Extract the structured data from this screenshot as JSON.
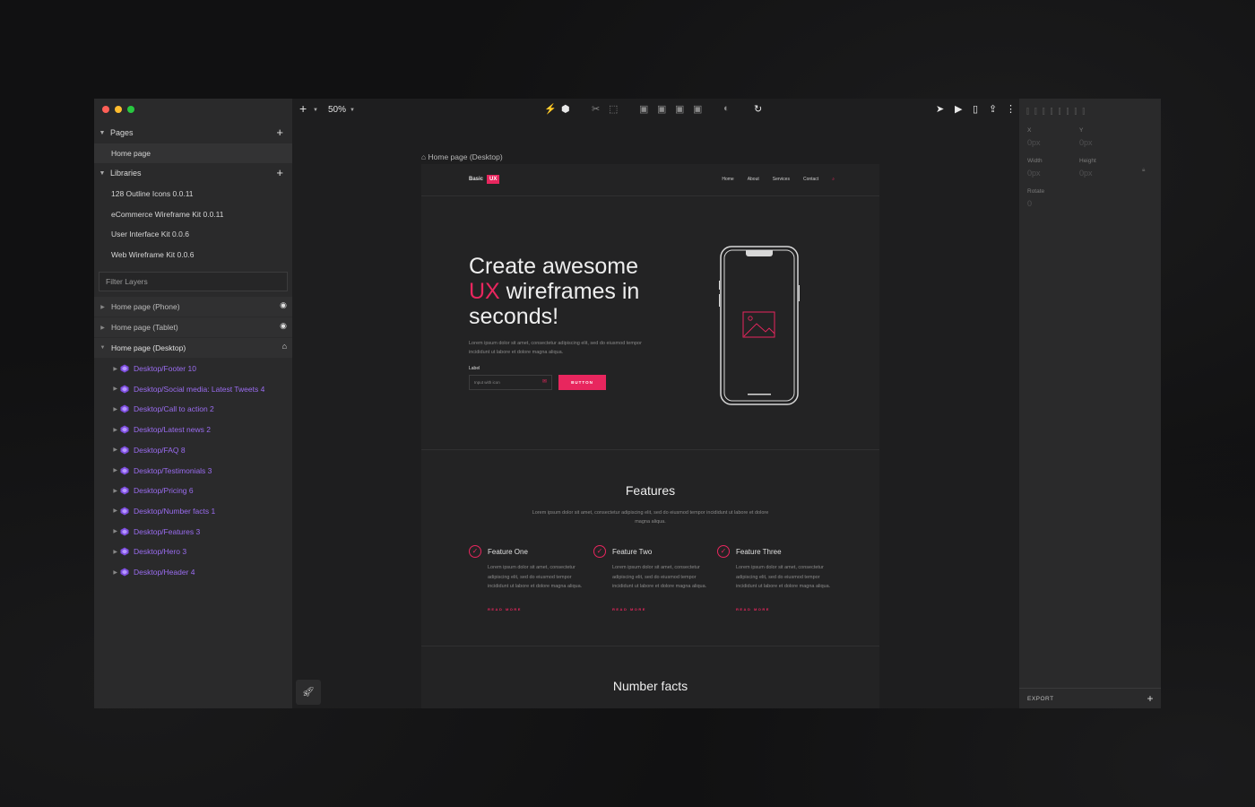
{
  "colors": {
    "accent": "#e8265e",
    "component": "#9a6cf0",
    "traffic": [
      "#ff5f57",
      "#febc2e",
      "#28c840"
    ]
  },
  "left": {
    "pages_label": "Pages",
    "pages": [
      "Home page"
    ],
    "libraries_label": "Libraries",
    "libraries": [
      "128 Outline Icons 0.0.11",
      "eCommerce Wireframe Kit 0.0.11",
      "User Interface Kit 0.0.6",
      "Web Wireframe Kit 0.0.6"
    ],
    "filter_placeholder": "Filter Layers",
    "top_layers": [
      "Home page (Phone)",
      "Home page (Tablet)",
      "Home page (Desktop)"
    ],
    "components": [
      "Desktop/Footer 10",
      "Desktop/Social media: Latest Tweets 4",
      "Desktop/Call to action 2",
      "Desktop/Latest news 2",
      "Desktop/FAQ 8",
      "Desktop/Testimonials 3",
      "Desktop/Pricing 6",
      "Desktop/Number facts 1",
      "Desktop/Features 3",
      "Desktop/Hero 3",
      "Desktop/Header 4"
    ]
  },
  "toolbar": {
    "zoom": "50%"
  },
  "canvas": {
    "frame_label": "Home page (Desktop)",
    "logo_text": "Basic",
    "logo_badge": "UX",
    "nav": [
      "Home",
      "About",
      "Services",
      "Contact"
    ],
    "hero": {
      "line1": "Create awesome",
      "accent": "UX",
      "line2": " wireframes in",
      "line3": "seconds!",
      "paragraph": "Lorem ipsum dolor sit amet, consectetur adipiscing elit, sed do eiusmod tempor incididunt ut labore et dolore magna aliqua.",
      "label": "Label",
      "input_placeholder": "Input with icon",
      "button": "BUTTON"
    },
    "features": {
      "title": "Features",
      "paragraph": "Lorem ipsum dolor sit amet, consectetur adipiscing elit, sed do eiusmod tempor incididunt ut labore et dolore magna aliqua.",
      "items": [
        {
          "title": "Feature One",
          "text": "Lorem ipsum dolor sit amet, consectetur adipiscing elit, sed do eiusmod tempor incididunt ut labore et dolore magna aliqua.",
          "link": "READ MORE"
        },
        {
          "title": "Feature Two",
          "text": "Lorem ipsum dolor sit amet, consectetur adipiscing elit, sed do eiusmod tempor incididunt ut labore et dolore magna aliqua.",
          "link": "READ MORE"
        },
        {
          "title": "Feature Three",
          "text": "Lorem ipsum dolor sit amet, consectetur adipiscing elit, sed do eiusmod tempor incididunt ut labore et dolore magna aliqua.",
          "link": "READ MORE"
        }
      ]
    },
    "number_facts_title": "Number facts"
  },
  "right": {
    "x_label": "X",
    "y_label": "Y",
    "x_val": "0px",
    "y_val": "0px",
    "width_label": "Width",
    "height_label": "Height",
    "width_val": "0px",
    "height_val": "0px",
    "rotate_label": "Rotate",
    "rotate_val": "0",
    "export_label": "EXPORT"
  }
}
